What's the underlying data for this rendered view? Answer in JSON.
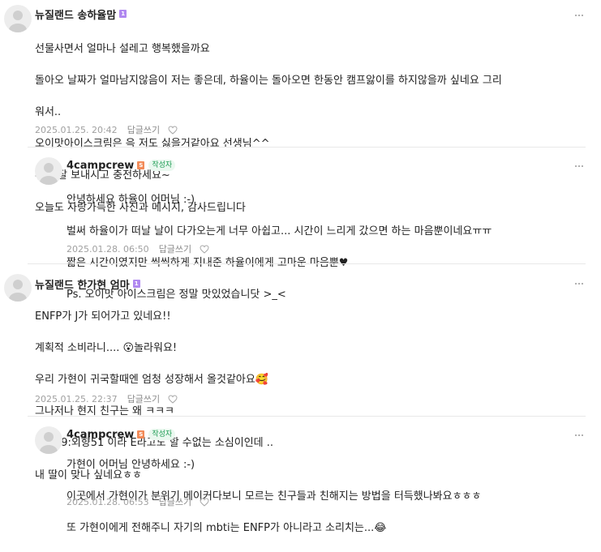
{
  "comments": [
    {
      "author": "뉴질랜드 송하율맘",
      "grade": "1",
      "lines": [
        "선물사면서 얼마나 설레고 행복했을까요",
        "돌아오 날짜가 얼마남지않음이 저는 좋은데, 하율이는 돌아오면 한동안 캠프앓이를 하지않을까 싶네요 그리",
        "워서..",
        "오이맛아이스크림은 윽 저도 싫을거같아요 선생님^^",
        "휴일 잘 보내시고 충전하세요~",
        "오늘도 사랑가득한 사진과 메시지, 감사드립니다"
      ],
      "date": "2025.01.25. 20:42",
      "reply_label": "답글쓰기"
    },
    {
      "author": "4campcrew",
      "grade": "S",
      "writer_badge": "작성자",
      "lines": [
        "안녕하세요 하율이 어머님 :-)",
        "벌써 하율이가 떠날 날이 다가오는게 너무 아쉽고... 시간이 느리게 갔으면 하는 마음뿐이네요ㅠㅠ",
        "짧은 시간이였지만 씩씩하게 지내준 하율이에게 고마운 마음뿐♥",
        "Ps. 오이맛 아이스크림은 정말 맛있었습니닷 >_<"
      ],
      "date": "2025.01.28. 06:50",
      "reply_label": "답글쓰기"
    },
    {
      "author": "뉴질랜드 한가현 엄마",
      "grade": "1",
      "lines": [
        "ENFP가 J가 되어가고 있네요!!",
        "계획적 소비라니.... 😮놀라워요!",
        "우리 가현이 귀국할때엔 엄청 성장해서 올것같아요🥰",
        "그나저나 현지 친구는 왜 ㅋㅋㅋ",
        "내향49:외향51 이라 E라고도 할 수없는 소심이인데 ..",
        "내 딸이 맞나 싶네요ㅎㅎ"
      ],
      "date": "2025.01.25. 22:37",
      "reply_label": "답글쓰기"
    },
    {
      "author": "4campcrew",
      "grade": "S",
      "writer_badge": "작성자",
      "lines": [
        "가현이 어머님 안녕하세요 :-)",
        "이곳에서 가현이가 분위기 메이커다보니 모르는 친구들과 친해지는 방법을 터득했나봐요ㅎㅎㅎ",
        "또 가현이에게 전해주니 자기의 mbti는 ENFP가 아니라고 소리치는...😂"
      ],
      "date": "2025.01.28. 06:53",
      "reply_label": "답글쓰기"
    }
  ],
  "icons": {
    "more": "more-dots-icon",
    "heart": "heart-outline-icon",
    "avatar": "default-avatar-icon"
  },
  "colors": {
    "grade_member": "#b088f0",
    "grade_staff": "#f28a57",
    "writer_badge": "#1f9d55"
  }
}
